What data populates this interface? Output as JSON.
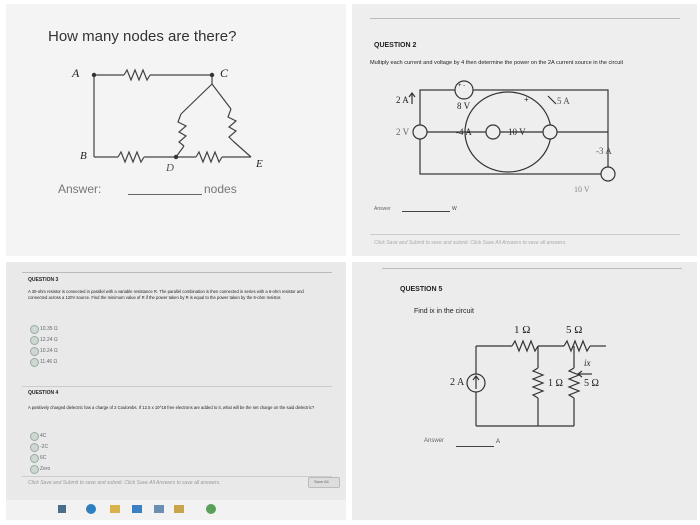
{
  "panel1": {
    "title": "How many nodes are there?",
    "node_labels": [
      "A",
      "C",
      "B",
      "D",
      "E"
    ],
    "answer_label": "Answer:",
    "answer_suffix": "nodes"
  },
  "panel2": {
    "heading": "QUESTION 2",
    "prompt": "Multiply each current and voltage by 4 then determine the power on the 2A current source in the circuit",
    "labels": {
      "plus_minus": "+ -",
      "src_8v": "8 V",
      "src_2a": "2 A",
      "src_5a": "5 A",
      "src_2v": "2 V",
      "src_4a": "-4 A",
      "src_10v": "10 V",
      "src_3a": "-3 A",
      "src_10v_right": "10 V",
      "plus": "+"
    },
    "answer_label": "Answer",
    "answer_unit": "W",
    "footer": "Click Save and Submit to save and submit. Click Save All Answers to save all answers."
  },
  "panel3": {
    "q3_heading": "QUESTION 3",
    "q3_text": "A 30-ohm resistor is connected in parallel with a variable resistance R. The parallel combination is then connected in series with a 6-ohm resistor and connected across a 120V source. Find the minimum value of R if the power taken by R is equal to the power taken by the 6-ohm resistor.",
    "q3_options": [
      "10.35 Ω",
      "12.24 Ω",
      "10.24 Ω",
      "11.46 Ω"
    ],
    "q4_heading": "QUESTION 4",
    "q4_text": "A positively charged dielectric has a charge of 2 Coulombs. If 12.5 x 10^18 free electrons are added to it, what will be the net charge on the said dielectric?",
    "q4_options": [
      "4C",
      "-2C",
      "6C",
      "Zero"
    ],
    "footer": "Click Save and Submit to save and submit. Click Save All Answers to save all answers.",
    "save_label": "Save All"
  },
  "panel4": {
    "heading": "QUESTION 5",
    "prompt": "Find ix in the circuit",
    "labels": {
      "r1_top": "1 Ω",
      "r2_top": "5 Ω",
      "ix": "ix",
      "src": "2 A",
      "r_mid": "1 Ω",
      "r_right": "5 Ω"
    },
    "answer_label": "Answer",
    "answer_unit": "A"
  },
  "colors": {
    "accent": "#3a6fb0",
    "circuit": "#333333"
  }
}
